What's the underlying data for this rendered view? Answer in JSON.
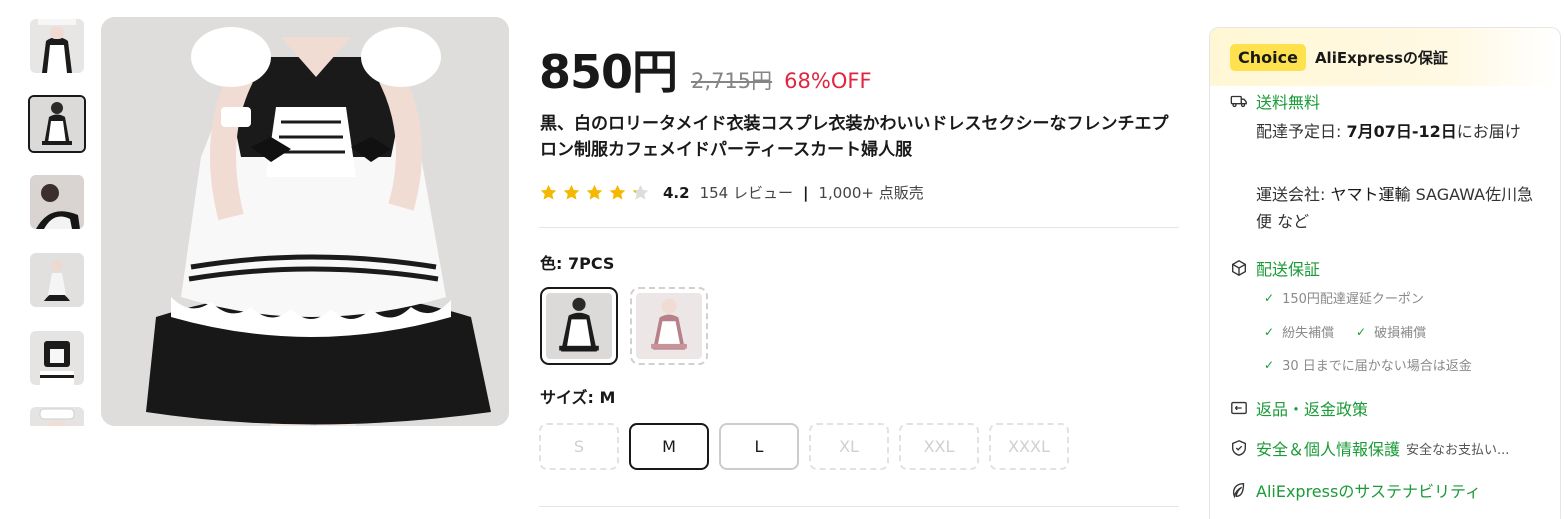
{
  "gallery": {
    "thumbnails": [
      "thumb-1",
      "thumb-2",
      "thumb-3",
      "thumb-4",
      "thumb-5",
      "thumb-6"
    ],
    "active_index": 1
  },
  "product": {
    "price": "850円",
    "original_price": "2,715円",
    "discount": "68%OFF",
    "title": "黒、白のロリータメイド衣装コスプレ衣装かわいいドレスセクシーなフレンチエプロン制服カフェメイドパーティースカート婦人服",
    "rating": {
      "stars": 4.2,
      "value": "4.2",
      "reviews": "154 レビュー",
      "separator": "|",
      "sold": "1,000+ 点販売"
    }
  },
  "variants": {
    "color_label": "色: 7PCS",
    "colors": [
      {
        "name": "black-white-maid",
        "selected": true
      },
      {
        "name": "pink-maid",
        "selected": false,
        "unavailable": true
      }
    ],
    "size_label": "サイズ: M",
    "sizes": [
      {
        "label": "S",
        "state": "disabled"
      },
      {
        "label": "M",
        "state": "selected"
      },
      {
        "label": "L",
        "state": "available"
      },
      {
        "label": "XL",
        "state": "disabled"
      },
      {
        "label": "XXL",
        "state": "disabled"
      },
      {
        "label": "XXXL",
        "state": "disabled"
      }
    ]
  },
  "guarantee": {
    "badge": "Choice",
    "title": "AliExpressの保証",
    "shipping": {
      "title": "送料無料",
      "delivery_prefix": "配達予定日: ",
      "delivery_dates": "7月07日-12日",
      "delivery_suffix": "にお届け",
      "carrier_prefix": "運送会社: ",
      "carrier_main": "ヤマト運輸",
      "carrier_rest": " SAGAWA佐川急便  など"
    },
    "delivery_guarantee": {
      "title": "配送保証",
      "items": [
        "150円配達遅延クーポン",
        "紛失補償",
        "破損補償",
        "30 日までに届かない場合は返金"
      ]
    },
    "returns": {
      "title": "返品・返金政策"
    },
    "security": {
      "title": "安全＆個人情報保護",
      "extra": "安全なお支払い..."
    },
    "sustainability": {
      "title": "AliExpressのサステナビリティ"
    },
    "accent_color": "#1a9b37",
    "badge_color": "#ffe14d"
  },
  "colors": {
    "discount": "#e2253f",
    "star": "#f5b800",
    "star_empty": "#dddddd"
  }
}
